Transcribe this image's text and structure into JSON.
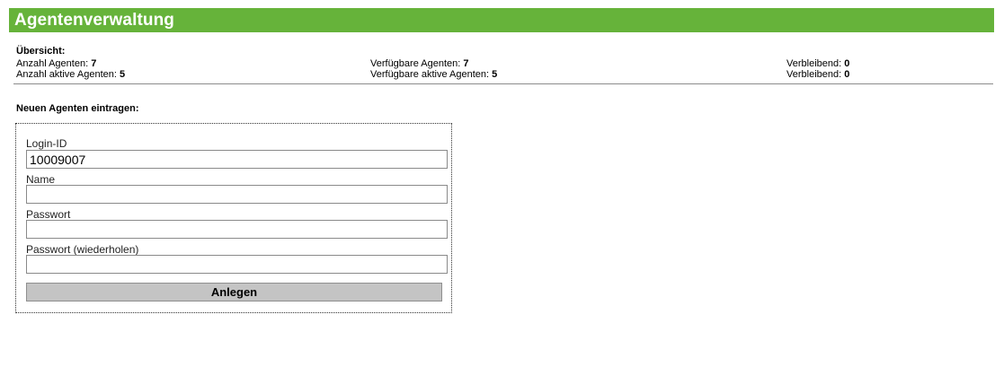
{
  "header": {
    "title": "Agentenverwaltung"
  },
  "overview": {
    "heading": "Übersicht:",
    "rows": [
      {
        "total_label": "Anzahl Agenten:",
        "total_value": "7",
        "available_label": "Verfügbare Agenten:",
        "available_value": "7",
        "remaining_label": "Verbleibend:",
        "remaining_value": "0"
      },
      {
        "total_label": "Anzahl aktive Agenten:",
        "total_value": "5",
        "available_label": "Verfügbare aktive Agenten:",
        "available_value": "5",
        "remaining_label": "Verbleibend:",
        "remaining_value": "0"
      }
    ]
  },
  "form": {
    "title": "Neuen Agenten eintragen:",
    "login_id": {
      "label": "Login-ID",
      "value": "10009007"
    },
    "name": {
      "label": "Name",
      "value": ""
    },
    "password": {
      "label": "Passwort",
      "value": ""
    },
    "password_repeat": {
      "label": "Passwort (wiederholen)",
      "value": ""
    },
    "submit_label": "Anlegen"
  },
  "colors": {
    "header_bg": "#66b33a",
    "header_text": "#ffffff",
    "button_bg": "#c4c4c4"
  }
}
